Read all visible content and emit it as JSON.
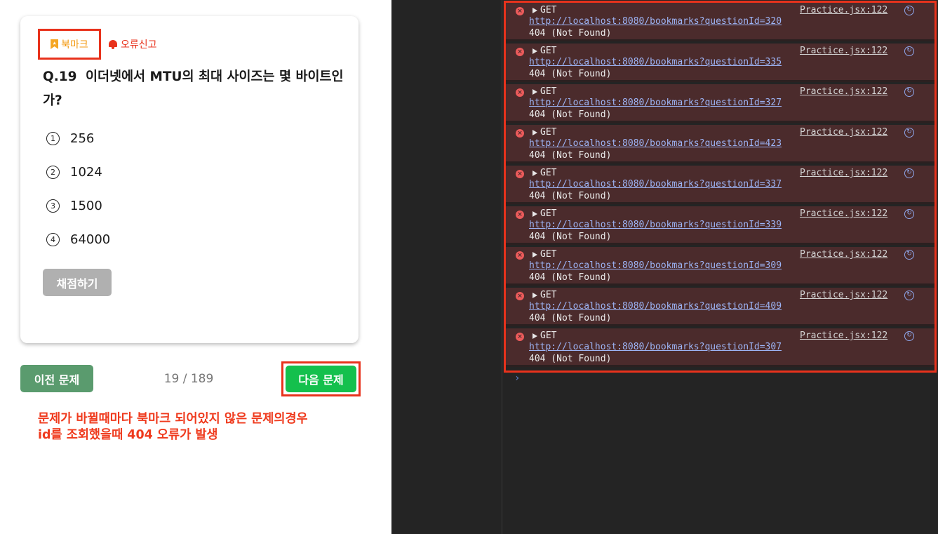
{
  "quiz": {
    "bookmark_label": "북마크",
    "report_label": "오류신고",
    "question_number": "Q.19",
    "question_text": "이더넷에서 MTU의 최대 사이즈는 몇 바이트인가?",
    "options": [
      {
        "num": "1",
        "text": "256"
      },
      {
        "num": "2",
        "text": "1024"
      },
      {
        "num": "3",
        "text": "1500"
      },
      {
        "num": "4",
        "text": "64000"
      }
    ],
    "grade_label": "채점하기"
  },
  "navigation": {
    "prev_label": "이전 문제",
    "progress": "19 / 189",
    "next_label": "다음 문제"
  },
  "annotation": {
    "line1": "문제가 바뀔때마다 북마크 되어있지 않은 문제의경우",
    "line2": "id를 조회했을때 404 오류가 발생"
  },
  "console": {
    "entries": [
      {
        "method": "GET",
        "url": "http://localhost:8080/bookmarks?questionId=320",
        "status": "404 (Not Found)",
        "source": "Practice.jsx:122"
      },
      {
        "method": "GET",
        "url": "http://localhost:8080/bookmarks?questionId=335",
        "status": "404 (Not Found)",
        "source": "Practice.jsx:122"
      },
      {
        "method": "GET",
        "url": "http://localhost:8080/bookmarks?questionId=327",
        "status": "404 (Not Found)",
        "source": "Practice.jsx:122"
      },
      {
        "method": "GET",
        "url": "http://localhost:8080/bookmarks?questionId=423",
        "status": "404 (Not Found)",
        "source": "Practice.jsx:122"
      },
      {
        "method": "GET",
        "url": "http://localhost:8080/bookmarks?questionId=337",
        "status": "404 (Not Found)",
        "source": "Practice.jsx:122"
      },
      {
        "method": "GET",
        "url": "http://localhost:8080/bookmarks?questionId=339",
        "status": "404 (Not Found)",
        "source": "Practice.jsx:122"
      },
      {
        "method": "GET",
        "url": "http://localhost:8080/bookmarks?questionId=309",
        "status": "404 (Not Found)",
        "source": "Practice.jsx:122"
      },
      {
        "method": "GET",
        "url": "http://localhost:8080/bookmarks?questionId=409",
        "status": "404 (Not Found)",
        "source": "Practice.jsx:122"
      },
      {
        "method": "GET",
        "url": "http://localhost:8080/bookmarks?questionId=307",
        "status": "404 (Not Found)",
        "source": "Practice.jsx:122"
      }
    ],
    "prompt": "›"
  },
  "colors": {
    "accent_red": "#e8321c",
    "next_green": "#14c04d",
    "prev_green": "#5a9b6e",
    "error_bg": "#4b2b2c"
  }
}
